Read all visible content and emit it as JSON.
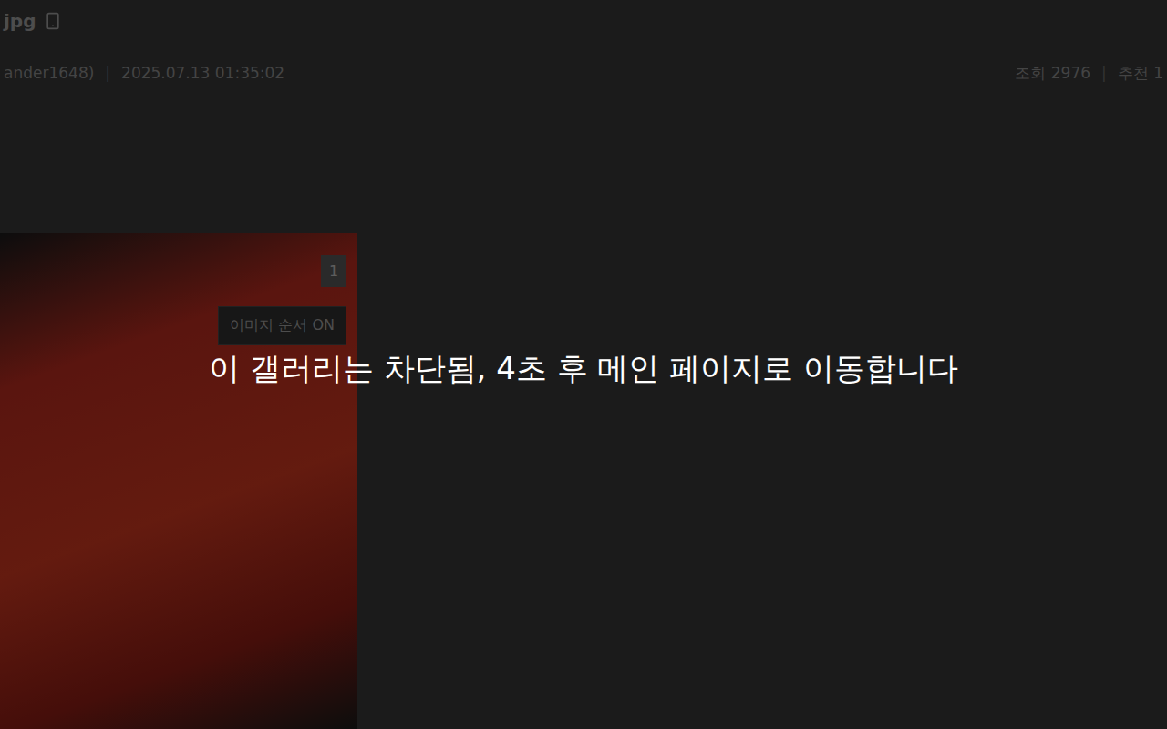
{
  "post": {
    "title": "jpg",
    "author": "ander1648)",
    "separator": "|",
    "date": "2025.07.13 01:35:02",
    "views": "조회 2976",
    "recommend": "추천 1"
  },
  "image": {
    "badge": "1",
    "order_button": "이미지 순서 ON"
  },
  "overlay": {
    "message": "이 갤러리는 차단됨, 4초 후 메인 페이지로 이동합니다"
  }
}
